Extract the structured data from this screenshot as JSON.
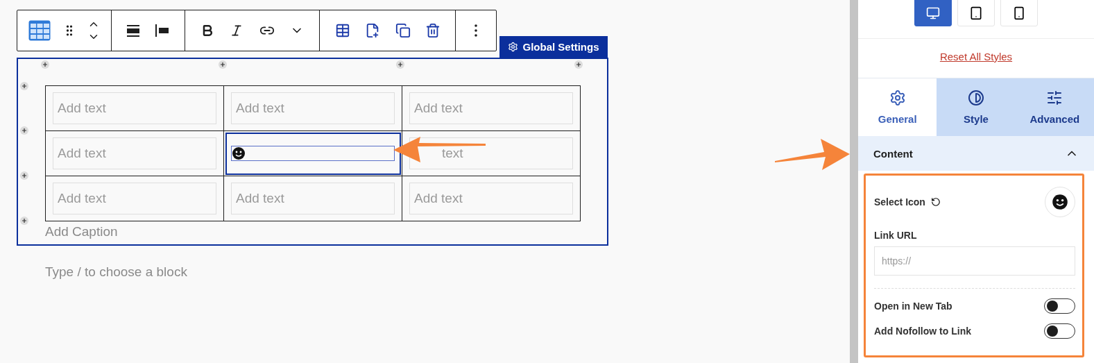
{
  "toolbar": {
    "badge": "Global Settings"
  },
  "table": {
    "rows": [
      {
        "cells": [
          {
            "kind": "text",
            "placeholder": "Add text",
            "selected": false
          },
          {
            "kind": "text",
            "placeholder": "Add text",
            "selected": false
          },
          {
            "kind": "text",
            "placeholder": "Add text",
            "selected": false
          }
        ]
      },
      {
        "cells": [
          {
            "kind": "text",
            "placeholder": "Add text",
            "selected": false
          },
          {
            "kind": "icon",
            "selected": true
          },
          {
            "kind": "covered",
            "placeholder": "text",
            "selected": false
          }
        ]
      },
      {
        "cells": [
          {
            "kind": "text",
            "placeholder": "Add text",
            "selected": false
          },
          {
            "kind": "text",
            "placeholder": "Add text",
            "selected": false
          },
          {
            "kind": "text",
            "placeholder": "Add text",
            "selected": false
          }
        ]
      }
    ],
    "caption_placeholder": "Add Caption"
  },
  "block_prompt": "Type / to choose a block",
  "sidebar": {
    "devices": [
      {
        "kind": "desktop",
        "selected": true
      },
      {
        "kind": "tablet",
        "selected": false
      },
      {
        "kind": "mobile",
        "selected": false
      }
    ],
    "reset_link": "Reset All Styles",
    "tabs": [
      {
        "kind": "general",
        "label": "General",
        "selected": true
      },
      {
        "kind": "style",
        "label": "Style",
        "selected": false
      },
      {
        "kind": "advanced",
        "label": "Advanced",
        "selected": false
      }
    ],
    "section": {
      "title": "Content",
      "expanded": true
    },
    "select_icon_label": "Select Icon",
    "link_url_label": "Link URL",
    "link_url_placeholder": "https://",
    "toggles": [
      {
        "label": "Open in New Tab",
        "on": false
      },
      {
        "label": "Add Nofollow to Link",
        "on": false
      }
    ]
  }
}
